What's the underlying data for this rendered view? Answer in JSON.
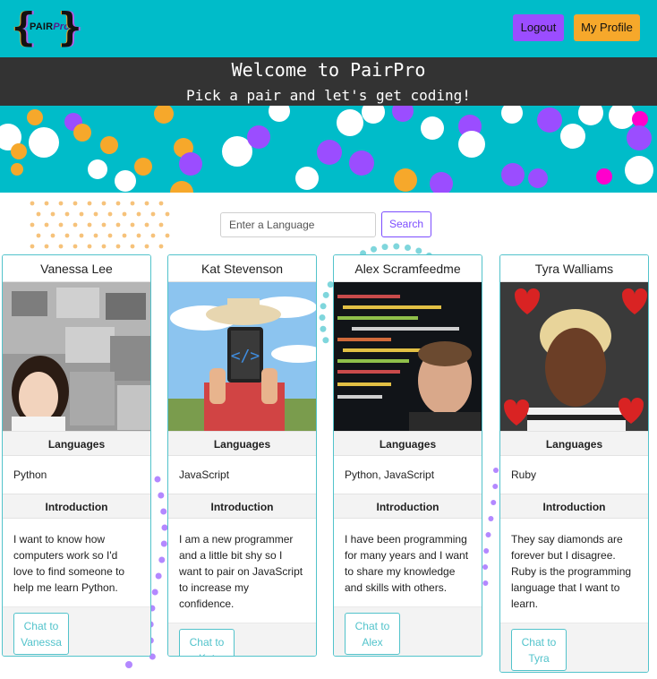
{
  "header": {
    "logo_text": "PairPro",
    "logo_text_pair": "PAIR",
    "logo_text_pro": "Pro",
    "logout_label": "Logout",
    "profile_label": "My Profile"
  },
  "welcome": {
    "title": "Welcome to PairPro",
    "subtitle": "Pick a pair and let's get coding!"
  },
  "search": {
    "placeholder": "Enter a Language",
    "button_label": "Search"
  },
  "colors": {
    "teal": "#00bcc9",
    "purple": "#9b4dff",
    "orange": "#f6a82b",
    "dark": "#333333",
    "card_border": "#52c3cb"
  },
  "cards": [
    {
      "name": "Vanessa Lee",
      "languages_heading": "Languages",
      "languages": "Python",
      "intro_heading": "Introduction",
      "intro": "I want to know how computers work so I'd love to find someone to help me learn Python.",
      "chat_label": "Chat to Vanessa",
      "photo_icon": "person-photo"
    },
    {
      "name": "Kat Stevenson",
      "languages_heading": "Languages",
      "languages": "JavaScript",
      "intro_heading": "Introduction",
      "intro": "I am a new programmer and a little bit shy so I want to pair on JavaScript to increase my confidence.",
      "chat_label": "Chat to Kat",
      "photo_icon": "person-photo"
    },
    {
      "name": "Alex Scramfeedme",
      "languages_heading": "Languages",
      "languages": "Python, JavaScript",
      "intro_heading": "Introduction",
      "intro": "I have been programming for many years and I want to share my knowledge and skills with others.",
      "chat_label": "Chat to Alex",
      "photo_icon": "person-photo"
    },
    {
      "name": "Tyra Walliams",
      "languages_heading": "Languages",
      "languages": "Ruby",
      "intro_heading": "Introduction",
      "intro": "They say diamonds are forever but I disagree. Ruby is the programming language that I want to learn.",
      "chat_label": "Chat to Tyra",
      "photo_icon": "person-photo"
    }
  ]
}
